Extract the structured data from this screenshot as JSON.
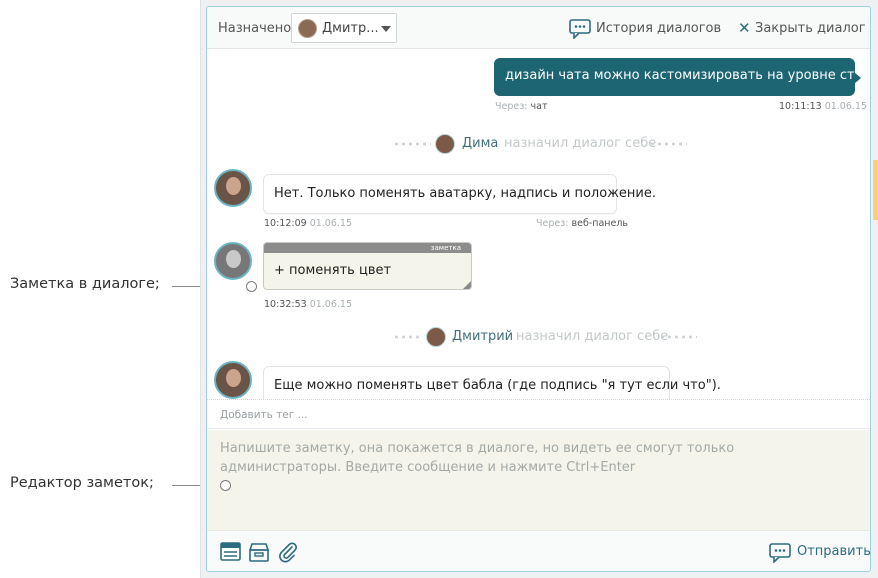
{
  "colors": {
    "accent": "#1d6573",
    "border": "#9fd2dc",
    "note_bg": "#f4f4ea",
    "note_header": "#8c8c8c"
  },
  "callouts": {
    "note_in_dialog": "Заметка в диалоге;",
    "notes_editor": "Редактор заметок;"
  },
  "header": {
    "assigned_label": "Назначено:",
    "assignee_name": "Дмитр...",
    "history_label": "История диалогов",
    "history_icon": "chat-bubble-icon",
    "close_label": "Закрыть диалог",
    "close_icon": "close-x-icon"
  },
  "messages": {
    "outgoing": {
      "text": "дизайн чата можно кастомизировать на уровне стилей?",
      "via_label": "Через:",
      "via_value": "чат",
      "time": "10:11:13",
      "date": "01.06.15"
    },
    "system1": {
      "name": "Дима",
      "action": "назначил диалог себе"
    },
    "incoming1": {
      "text": "Нет. Только поменять аватарку, надпись и положение.",
      "time": "10:12:09",
      "date": "01.06.15",
      "via_label": "Через:",
      "via_value": "веб-панель"
    },
    "note": {
      "label": "заметка",
      "text": "+ поменять цвет",
      "time": "10:32:53",
      "date": "01.06.15"
    },
    "system2": {
      "name": "Дмитрий",
      "action": "назначил диалог себе"
    },
    "incoming2": {
      "text": "Еще можно поменять цвет бабла (где подпись \"я тут если что\")."
    }
  },
  "tag_input": {
    "placeholder": "Добавить тег ..."
  },
  "editor": {
    "placeholder": "Напишите заметку, она покажется в диалоге, но видеть ее смогут только администраторы. Введите сообщение и нажмите Ctrl+Enter"
  },
  "footer": {
    "icons": [
      "notes-icon",
      "archive-box-icon",
      "paperclip-icon"
    ],
    "send_label": "Отправить",
    "send_icon": "chat-bubble-icon"
  }
}
